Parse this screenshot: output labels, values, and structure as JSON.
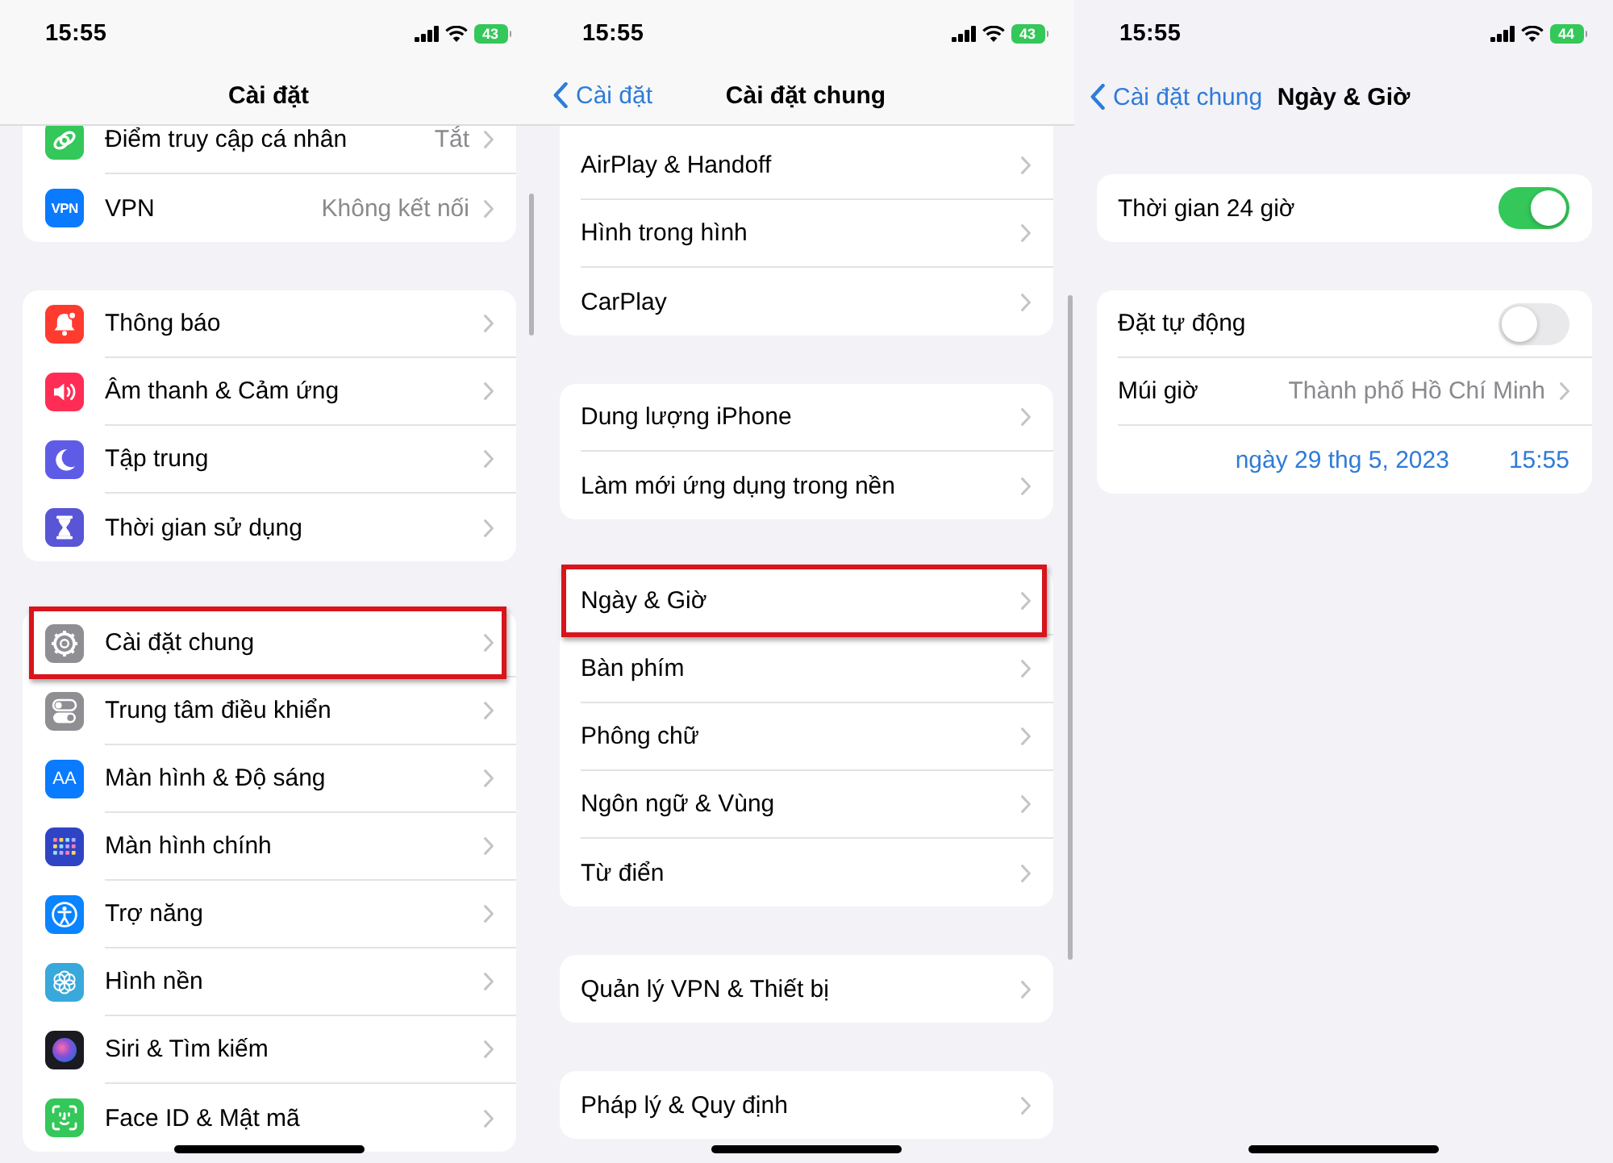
{
  "panels": [
    {
      "status_bar": {
        "time": "15:55",
        "battery": "43"
      },
      "nav_bar": {
        "title": "Cài đặt"
      },
      "scrolled": true,
      "groups": [
        {
          "rows": [
            {
              "kind": "link",
              "label": "Điểm truy cập cá nhân",
              "value": "Tắt",
              "highlighted": false
            },
            {
              "kind": "link",
              "icon_text": "VPN",
              "label": "VPN",
              "value": "Không kết nối",
              "highlighted": false
            }
          ]
        },
        {
          "rows": [
            {
              "kind": "link",
              "label": "Thông báo",
              "highlighted": false
            },
            {
              "kind": "link",
              "label": "Âm thanh & Cảm ứng",
              "highlighted": false
            },
            {
              "kind": "link",
              "label": "Tập trung",
              "highlighted": false
            },
            {
              "kind": "link",
              "label": "Thời gian sử dụng",
              "highlighted": false
            }
          ]
        },
        {
          "rows": [
            {
              "kind": "link",
              "label": "Cài đặt chung",
              "highlighted": true
            },
            {
              "kind": "link",
              "label": "Trung tâm điều khiển",
              "highlighted": false
            },
            {
              "kind": "link",
              "icon_text": "AA",
              "label": "Màn hình & Độ sáng",
              "highlighted": false
            },
            {
              "kind": "link",
              "label": "Màn hình chính",
              "highlighted": false
            },
            {
              "kind": "link",
              "label": "Trợ năng",
              "highlighted": false
            },
            {
              "kind": "link",
              "label": "Hình nền",
              "highlighted": false
            },
            {
              "kind": "link",
              "label": "Siri & Tìm kiếm",
              "highlighted": false
            },
            {
              "kind": "link",
              "label": "Face ID & Mật mã",
              "highlighted": false
            }
          ]
        }
      ]
    },
    {
      "status_bar": {
        "time": "15:55",
        "battery": "43"
      },
      "nav_bar": {
        "back": "Cài đặt",
        "title": "Cài đặt chung"
      },
      "scrolled": true,
      "groups": [
        {
          "rows": [
            {
              "kind": "link",
              "label": "AirPlay & Handoff",
              "highlighted": false
            },
            {
              "kind": "link",
              "label": "Hình trong hình",
              "highlighted": false
            },
            {
              "kind": "link",
              "label": "CarPlay",
              "highlighted": false
            }
          ]
        },
        {
          "rows": [
            {
              "kind": "link",
              "label": "Dung lượng iPhone",
              "highlighted": false
            },
            {
              "kind": "link",
              "label": "Làm mới ứng dụng trong nền",
              "highlighted": false
            }
          ]
        },
        {
          "rows": [
            {
              "kind": "link",
              "label": "Ngày & Giờ",
              "highlighted": true
            },
            {
              "kind": "link",
              "label": "Bàn phím",
              "highlighted": false
            },
            {
              "kind": "link",
              "label": "Phông chữ",
              "highlighted": false
            },
            {
              "kind": "link",
              "label": "Ngôn ngữ & Vùng",
              "highlighted": false
            },
            {
              "kind": "link",
              "label": "Từ điển",
              "highlighted": false
            }
          ]
        },
        {
          "rows": [
            {
              "kind": "link",
              "label": "Quản lý VPN & Thiết bị",
              "highlighted": false
            }
          ]
        },
        {
          "rows": [
            {
              "kind": "link",
              "label": "Pháp lý & Quy định",
              "highlighted": false
            }
          ]
        }
      ]
    },
    {
      "status_bar": {
        "time": "15:55",
        "battery": "44"
      },
      "nav_bar": {
        "back": "Cài đặt chung",
        "title": "Ngày & Giờ"
      },
      "groups": [
        {
          "rows": [
            {
              "kind": "toggle",
              "label": "Thời gian 24 giờ",
              "on": true
            }
          ]
        },
        {
          "rows": [
            {
              "kind": "toggle",
              "label": "Đặt tự động",
              "on": false
            },
            {
              "kind": "link",
              "label": "Múi giờ",
              "value": "Thành phố Hồ Chí Minh"
            },
            {
              "kind": "datetime",
              "date": "ngày 29 thg 5, 2023",
              "time": "15:55"
            }
          ]
        }
      ]
    }
  ]
}
